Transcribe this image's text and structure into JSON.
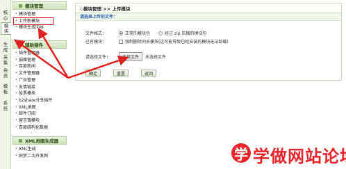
{
  "vtabs": [
    {
      "label": "核\n心",
      "active": false
    },
    {
      "label": "模\n块",
      "active": true
    },
    {
      "label": "生\n成",
      "active": false
    },
    {
      "label": "采\n集",
      "active": false
    },
    {
      "label": "会\n员",
      "active": false
    },
    {
      "label": "模\n板",
      "active": false
    },
    {
      "label": "系\n统",
      "active": false
    }
  ],
  "sidebar": {
    "sections": [
      {
        "title": "模块管理",
        "items": [
          "模块管理",
          "上传新模块",
          "模块生成向导"
        ]
      },
      {
        "title": "辅助插件",
        "items": [
          "插件管理器",
          "捐赠管理",
          "百度新闻",
          "文件管理器",
          "广告管理",
          "友情链接",
          "投票模块",
          "b2share分享插件",
          "XML地图",
          "邮件订阅",
          "留言簿模块",
          "百度结构化数据"
        ]
      },
      {
        "title": "XML地图生成器",
        "items": [
          "XML生成",
          "织梦二次开发网"
        ]
      }
    ]
  },
  "main": {
    "breadcrumb": "◇模块管理  >> 上传模块",
    "subhead": "请选择上传的文件：",
    "format_label": "文件格式：",
    "format_option1": "正常的模块包",
    "format_option2": "经过 zip 压缩的模块包",
    "existing_label": "已有模块：",
    "existing_option": "强制删除同名模块(这可能导致已经安装的模块无法卸载)",
    "file_label": "请选择文件：",
    "file_button": "选择文件",
    "file_status": "未选择文件",
    "btn_confirm": "确定",
    "btn_reset": "重置",
    "btn_back": "返回"
  },
  "watermark": {
    "circle": "学",
    "text": "学做网站论坛"
  },
  "colors": {
    "accent_green": "#cfe2bb",
    "link_blue": "#2a5ea8",
    "arrow_red": "#e02020",
    "watermark_red": "#e8242b"
  }
}
